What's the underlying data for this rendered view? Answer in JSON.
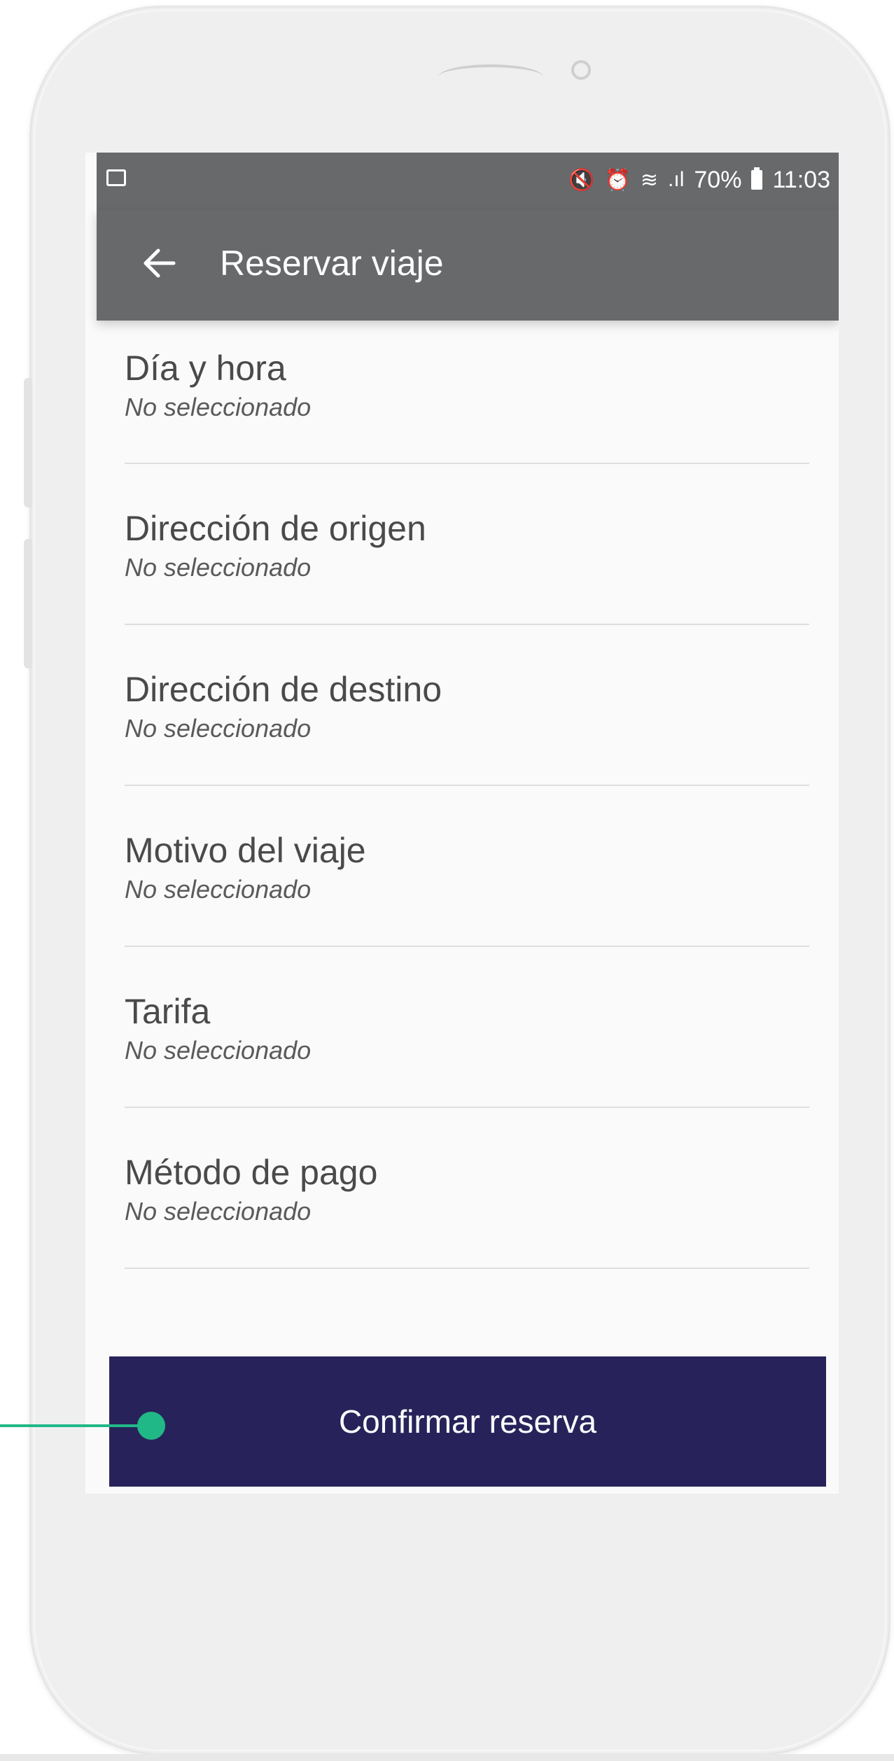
{
  "statusbar": {
    "icons": [
      "image-icon",
      "mute-icon",
      "alarm-icon",
      "wifi-icon",
      "signal-icon",
      "battery-icon"
    ],
    "battery": "70%",
    "time": "11:03"
  },
  "appbar": {
    "back_icon": "arrow-left-icon",
    "title": "Reservar viaje"
  },
  "form": {
    "items": [
      {
        "label": "Día y hora",
        "value": "No seleccionado"
      },
      {
        "label": "Dirección de origen",
        "value": "No seleccionado"
      },
      {
        "label": "Dirección de destino",
        "value": "No seleccionado"
      },
      {
        "label": "Motivo del viaje",
        "value": "No seleccionado"
      },
      {
        "label": "Tarifa",
        "value": "No seleccionado"
      },
      {
        "label": "Método de pago",
        "value": "No seleccionado"
      }
    ]
  },
  "confirm_button": {
    "label": "Confirmar reserva"
  },
  "colors": {
    "appbar": "#67696b",
    "button": "#27235a",
    "callout": "#21b888"
  }
}
